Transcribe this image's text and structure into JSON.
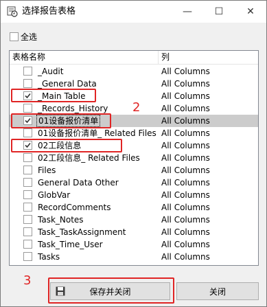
{
  "window": {
    "title": "选择报告表格",
    "controls": {
      "minimize": "—",
      "maximize": "☐",
      "close": "✕"
    }
  },
  "select_all": {
    "label": "全选",
    "checked": false
  },
  "list": {
    "headers": {
      "name": "表格名称",
      "columns": "列"
    },
    "rows": [
      {
        "name": "_Audit",
        "columns": "All Columns",
        "checked": false,
        "selected": false
      },
      {
        "name": "_General Data",
        "columns": "All Columns",
        "checked": false,
        "selected": false
      },
      {
        "name": "_Main Table",
        "columns": "All Columns",
        "checked": true,
        "selected": false
      },
      {
        "name": "_Records_History",
        "columns": "All Columns",
        "checked": false,
        "selected": false
      },
      {
        "name": "01设备报价清单",
        "columns": "All Columns",
        "checked": true,
        "selected": true
      },
      {
        "name": "01设备报价清单_ Related Files",
        "columns": "All Columns",
        "checked": false,
        "selected": false
      },
      {
        "name": "02工段信息",
        "columns": "All Columns",
        "checked": true,
        "selected": false
      },
      {
        "name": "02工段信息_ Related Files",
        "columns": "All Columns",
        "checked": false,
        "selected": false
      },
      {
        "name": "Files",
        "columns": "All Columns",
        "checked": false,
        "selected": false
      },
      {
        "name": "General Data Other",
        "columns": "All Columns",
        "checked": false,
        "selected": false
      },
      {
        "name": "GlobVar",
        "columns": "All Columns",
        "checked": false,
        "selected": false
      },
      {
        "name": "RecordComments",
        "columns": "All Columns",
        "checked": false,
        "selected": false
      },
      {
        "name": "Task_Notes",
        "columns": "All Columns",
        "checked": false,
        "selected": false
      },
      {
        "name": "Task_TaskAssignment",
        "columns": "All Columns",
        "checked": false,
        "selected": false
      },
      {
        "name": "Task_Time_User",
        "columns": "All Columns",
        "checked": false,
        "selected": false
      },
      {
        "name": "Tasks",
        "columns": "All Columns",
        "checked": false,
        "selected": false
      }
    ]
  },
  "annotations": {
    "step2": "2",
    "step3": "3"
  },
  "buttons": {
    "save_close": "保存并关闭",
    "close": "关闭"
  },
  "colors": {
    "annotation_red": "#e02424",
    "selected_row": "#cccccc"
  },
  "icons": {
    "app": "report-table-icon",
    "save": "floppy-disk-icon"
  }
}
